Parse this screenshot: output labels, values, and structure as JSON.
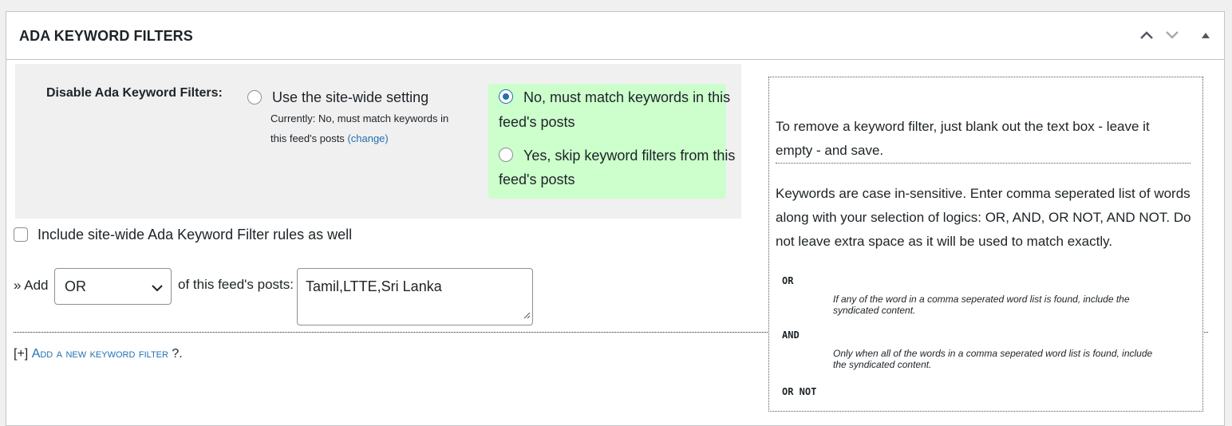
{
  "panel": {
    "title": "ADA KEYWORD FILTERS",
    "controls": [
      "move-up",
      "move-down",
      "toggle-panel"
    ]
  },
  "disable_setting": {
    "label": "Disable Ada Keyword Filters:",
    "options": [
      {
        "label": "Use the site-wide setting",
        "checked": false
      },
      {
        "label_line1": "No, must match keywords in this",
        "label_line2": "feed's posts",
        "checked": true
      },
      {
        "label_line1": "Yes, skip keyword filters from this",
        "label_line2": "feed's posts",
        "checked": false
      }
    ],
    "currently_line1": "Currently: No, must match keywords in",
    "currently_line2": "this feed's posts",
    "change_link": "(change)"
  },
  "include_sitewide": {
    "label": "Include site-wide Ada Keyword Filter rules as well",
    "checked": false
  },
  "add_filter": {
    "prefix": "» Add",
    "logic_selected": "OR",
    "suffix": "of this feed's posts:",
    "keywords_value": "Tamil,LTTE,Sri Lanka"
  },
  "add_new": {
    "bracket": "[+]",
    "link": "Add a new keyword filter",
    "tail": "?."
  },
  "help": {
    "remove_line1": "To remove a keyword filter, just blank out the text box - leave it",
    "remove_line2": "empty - and save.",
    "keywords_line1": "Keywords are case in-sensitive. Enter comma seperated list of words",
    "keywords_line2": "along with your selection of logics: OR, AND, OR NOT, AND NOT. Do",
    "keywords_line3": "not leave extra space as it will be used to match exactly.",
    "logics": [
      {
        "op": "OR",
        "desc_line1": "If any of the word in a comma seperated word list is found, include the",
        "desc_line2": "syndicated content."
      },
      {
        "op": "AND",
        "desc_line1": "Only when all of the words in a comma seperated word list is found, include",
        "desc_line2": "the syndicated content."
      },
      {
        "op": "OR NOT",
        "desc_line1": "",
        "desc_line2": ""
      }
    ]
  },
  "colors": {
    "accent": "#2271b1",
    "selected_bg": "#ccffcc",
    "panel_border": "#c3c4c7"
  }
}
